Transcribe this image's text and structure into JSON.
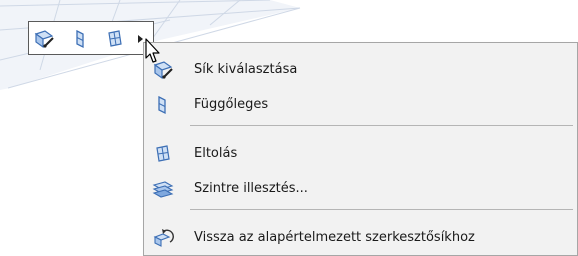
{
  "menu": {
    "items": [
      {
        "label": "Sík kiválasztása",
        "icon": "select-plane-icon"
      },
      {
        "label": "Függőleges",
        "icon": "vertical-plane-icon"
      },
      {
        "label": "Eltolás",
        "icon": "offset-plane-icon"
      },
      {
        "label": "Szintre illesztés...",
        "icon": "fit-to-level-icon"
      },
      {
        "label": "Vissza az alapértelmezett szerkesztősíkhoz",
        "icon": "reset-plane-icon"
      }
    ]
  },
  "toolbar": {
    "buttons": [
      "select-plane-icon",
      "vertical-plane-icon",
      "offset-plane-icon",
      "more-arrow-icon"
    ]
  },
  "colors": {
    "menu_background": "#f2f2f2",
    "icon_blue": "#3d6fb5",
    "grid_line": "#d4dce8"
  }
}
